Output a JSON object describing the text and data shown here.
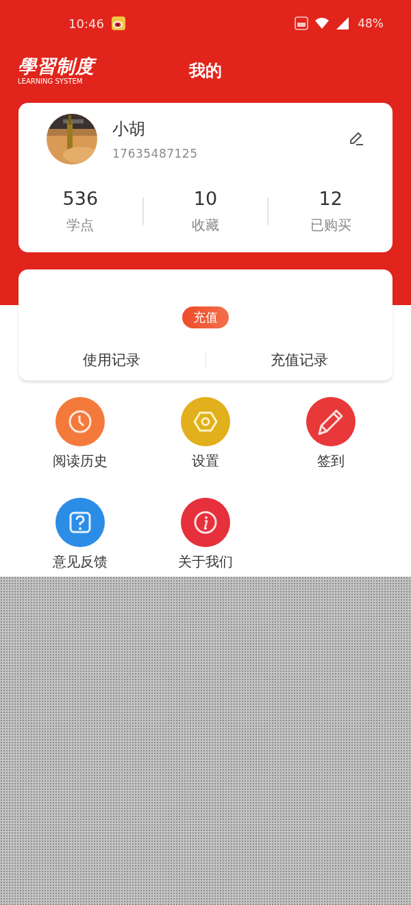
{
  "status_bar": {
    "time": "10:46",
    "battery": "48%"
  },
  "header": {
    "logo_title": "學習制度",
    "logo_subtitle": "LEARNING SYSTEM",
    "title": "我的"
  },
  "profile": {
    "name": "小胡",
    "phone": "17635487125",
    "stats": [
      {
        "value": "536",
        "label": "学点"
      },
      {
        "value": "10",
        "label": "收藏"
      },
      {
        "value": "12",
        "label": "已购买"
      }
    ]
  },
  "wallet": {
    "button": "充值",
    "links": [
      "使用记录",
      "充值记录"
    ]
  },
  "menu": [
    {
      "label": "阅读历史",
      "kind": "clock",
      "color": "#f47a3c"
    },
    {
      "label": "设置",
      "kind": "settings",
      "color": "#e2b01c"
    },
    {
      "label": "签到",
      "kind": "pencil",
      "color": "#e8383a"
    },
    {
      "label": "意见反馈",
      "kind": "help",
      "color": "#2b8de6"
    },
    {
      "label": "关于我们",
      "kind": "info",
      "color": "#e6303c"
    }
  ]
}
